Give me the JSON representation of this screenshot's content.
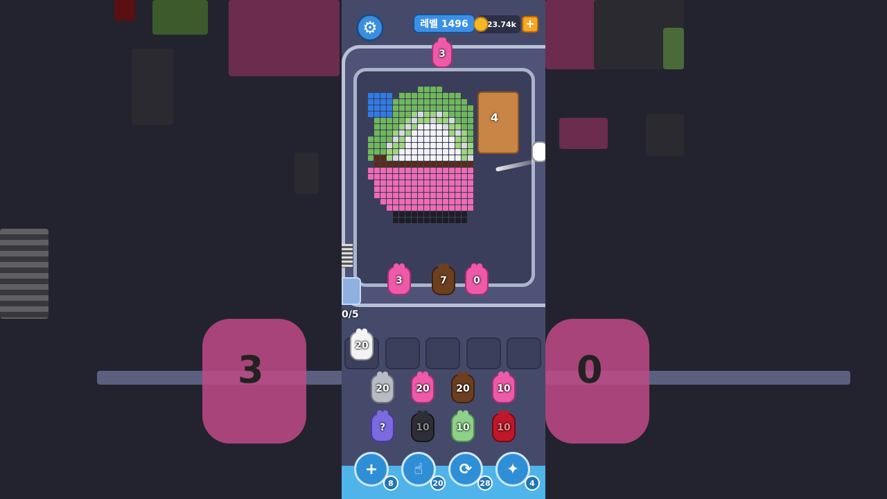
{
  "header": {
    "level_label": "레벨 1496",
    "coins": "23.74k",
    "add_coins_label": "+"
  },
  "queue_pig_top": {
    "count": "3",
    "color": "pink"
  },
  "board": {
    "wood_stack_count": "4",
    "hand_label": "1("
  },
  "conveyor_pigs": [
    {
      "count": "3",
      "color": "pink"
    },
    {
      "count": "7",
      "color": "brown"
    },
    {
      "count": "0",
      "color": "pink"
    }
  ],
  "holding": {
    "counter": "0/5",
    "slots": [
      {
        "count": "20",
        "color": "white"
      },
      {
        "count": "",
        "color": "empty"
      },
      {
        "count": "",
        "color": "empty"
      },
      {
        "count": "",
        "color": "empty"
      },
      {
        "count": "",
        "color": "empty"
      }
    ]
  },
  "pig_grid": {
    "row1": [
      {
        "count": "20",
        "color": "grey"
      },
      {
        "count": "20",
        "color": "pink"
      },
      {
        "count": "20",
        "color": "brown"
      },
      {
        "count": "10",
        "color": "pink"
      }
    ],
    "row2": [
      {
        "count": "?",
        "color": "purple"
      },
      {
        "count": "10",
        "color": "black"
      },
      {
        "count": "10",
        "color": "green"
      },
      {
        "count": "10",
        "color": "red"
      }
    ]
  },
  "boosters": [
    {
      "icon": "add-slot-icon",
      "glyph": "+",
      "count": "8"
    },
    {
      "icon": "hand-tap-icon",
      "glyph": "☝",
      "count": "20"
    },
    {
      "icon": "shuffle-icon",
      "glyph": "⟳",
      "count": "28"
    },
    {
      "icon": "magnet-pig-icon",
      "glyph": "✦",
      "count": "4"
    }
  ],
  "background_pigs": [
    {
      "count": "3"
    },
    {
      "count": "0"
    }
  ],
  "colors": {
    "pink": "#ee5aa8",
    "brown": "#6b3f1f",
    "accent_blue": "#3a90e6",
    "coin_gold": "#f3b82a"
  }
}
